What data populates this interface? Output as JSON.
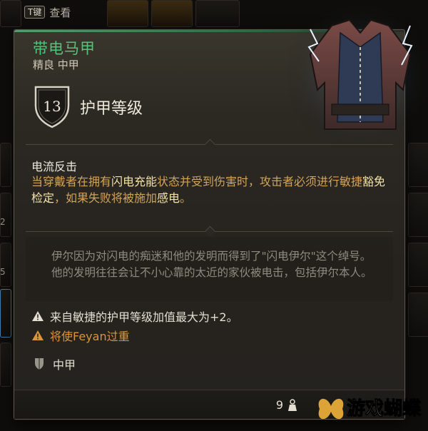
{
  "hint": {
    "key": "T键",
    "label": "查看"
  },
  "edge_numbers": [
    "2",
    "5"
  ],
  "item": {
    "name": "带电马甲",
    "subtitle": "精良 中甲",
    "armor_class": "13",
    "armor_class_label": "护甲等级"
  },
  "effect": {
    "title": "电流反击",
    "parts": [
      "当穿戴者在拥有",
      "闪电充能",
      "状态并受到伤害时，攻击者必须进行敏捷",
      "豁免检定",
      "，如果失败将被施加",
      "感电",
      "。"
    ]
  },
  "lore": "伊尔因为对闪电的痴迷和他的发明而得到了\"闪电伊尔\"这个绰号。他的发明往往会让不小心靠的太近的家伙被电击，包括伊尔本人。",
  "notes": [
    {
      "icon": "warning-icon",
      "text": "来自敏捷的护甲等级加值最大为+2。"
    },
    {
      "icon": "warning-icon",
      "text": "将使Feyan过重"
    }
  ],
  "armor_type": "中甲",
  "weight": "9",
  "watermark": "游戏蝴蝶",
  "colors": {
    "item_name": "#4ec77a",
    "effect_text": "#d2a35a",
    "effect_highlight": "#f3e2a8",
    "warning": "#d9943c"
  }
}
